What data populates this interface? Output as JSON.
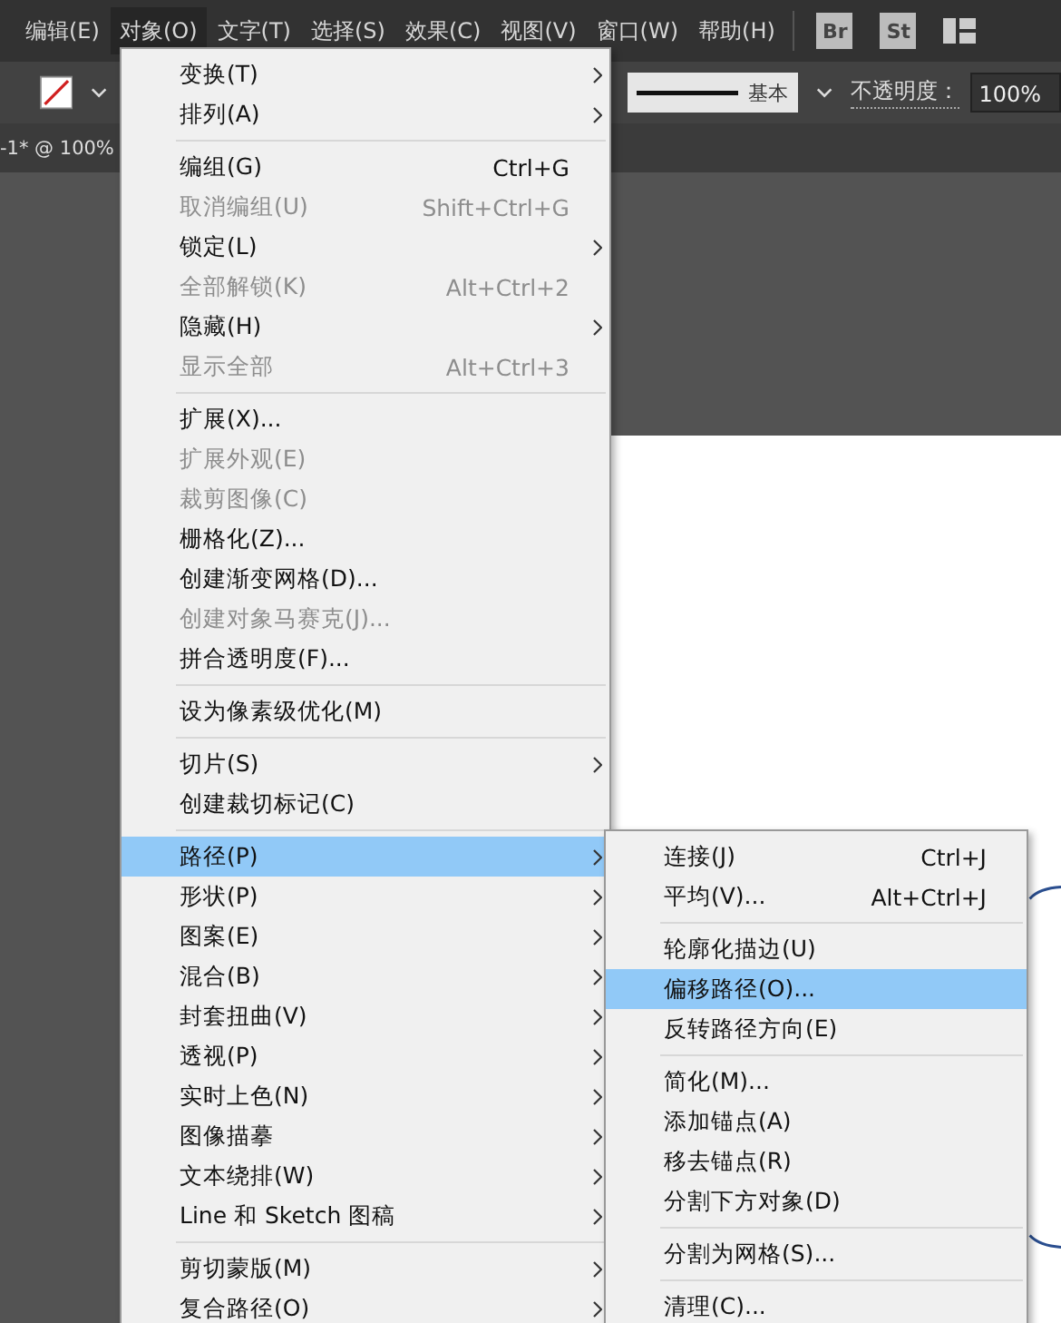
{
  "menubar": [
    {
      "label": "编辑(E)",
      "selected": false
    },
    {
      "label": "对象(O)",
      "selected": true
    },
    {
      "label": "文字(T)",
      "selected": false
    },
    {
      "label": "选择(S)",
      "selected": false
    },
    {
      "label": "效果(C)",
      "selected": false
    },
    {
      "label": "视图(V)",
      "selected": false
    },
    {
      "label": "窗口(W)",
      "selected": false
    },
    {
      "label": "帮助(H)",
      "selected": false
    }
  ],
  "app_buttons": [
    "Br",
    "St"
  ],
  "toolbar": {
    "stroke_style": "基本",
    "opacity_label": "不透明度：",
    "opacity_value": "100%"
  },
  "document_tab": {
    "title": "-1* @ 100%"
  },
  "menu": {
    "items": [
      {
        "kind": "item",
        "label": "变换(T)",
        "disabled": false,
        "submenu": true,
        "selected": false
      },
      {
        "kind": "item",
        "label": "排列(A)",
        "disabled": false,
        "submenu": true,
        "selected": false
      },
      {
        "kind": "separator"
      },
      {
        "kind": "item",
        "label": "编组(G)",
        "shortcut": "Ctrl+G",
        "disabled": false,
        "submenu": false,
        "selected": false
      },
      {
        "kind": "item",
        "label": "取消编组(U)",
        "shortcut": "Shift+Ctrl+G",
        "disabled": true,
        "submenu": false,
        "selected": false
      },
      {
        "kind": "item",
        "label": "锁定(L)",
        "disabled": false,
        "submenu": true,
        "selected": false
      },
      {
        "kind": "item",
        "label": "全部解锁(K)",
        "shortcut": "Alt+Ctrl+2",
        "disabled": true,
        "submenu": false,
        "selected": false
      },
      {
        "kind": "item",
        "label": "隐藏(H)",
        "disabled": false,
        "submenu": true,
        "selected": false
      },
      {
        "kind": "item",
        "label": "显示全部",
        "shortcut": "Alt+Ctrl+3",
        "disabled": true,
        "submenu": false,
        "selected": false
      },
      {
        "kind": "separator"
      },
      {
        "kind": "item",
        "label": "扩展(X)...",
        "disabled": false,
        "submenu": false,
        "selected": false
      },
      {
        "kind": "item",
        "label": "扩展外观(E)",
        "disabled": true,
        "submenu": false,
        "selected": false
      },
      {
        "kind": "item",
        "label": "裁剪图像(C)",
        "disabled": true,
        "submenu": false,
        "selected": false
      },
      {
        "kind": "item",
        "label": "栅格化(Z)...",
        "disabled": false,
        "submenu": false,
        "selected": false
      },
      {
        "kind": "item",
        "label": "创建渐变网格(D)...",
        "disabled": false,
        "submenu": false,
        "selected": false
      },
      {
        "kind": "item",
        "label": "创建对象马赛克(J)...",
        "disabled": true,
        "submenu": false,
        "selected": false
      },
      {
        "kind": "item",
        "label": "拼合透明度(F)...",
        "disabled": false,
        "submenu": false,
        "selected": false
      },
      {
        "kind": "separator"
      },
      {
        "kind": "item",
        "label": "设为像素级优化(M)",
        "disabled": false,
        "submenu": false,
        "selected": false
      },
      {
        "kind": "separator"
      },
      {
        "kind": "item",
        "label": "切片(S)",
        "disabled": false,
        "submenu": true,
        "selected": false
      },
      {
        "kind": "item",
        "label": "创建裁切标记(C)",
        "disabled": false,
        "submenu": false,
        "selected": false
      },
      {
        "kind": "separator"
      },
      {
        "kind": "item",
        "label": "路径(P)",
        "disabled": false,
        "submenu": true,
        "selected": true
      },
      {
        "kind": "item",
        "label": "形状(P)",
        "disabled": false,
        "submenu": true,
        "selected": false
      },
      {
        "kind": "item",
        "label": "图案(E)",
        "disabled": false,
        "submenu": true,
        "selected": false
      },
      {
        "kind": "item",
        "label": "混合(B)",
        "disabled": false,
        "submenu": true,
        "selected": false
      },
      {
        "kind": "item",
        "label": "封套扭曲(V)",
        "disabled": false,
        "submenu": true,
        "selected": false
      },
      {
        "kind": "item",
        "label": "透视(P)",
        "disabled": false,
        "submenu": true,
        "selected": false
      },
      {
        "kind": "item",
        "label": "实时上色(N)",
        "disabled": false,
        "submenu": true,
        "selected": false
      },
      {
        "kind": "item",
        "label": "图像描摹",
        "disabled": false,
        "submenu": true,
        "selected": false
      },
      {
        "kind": "item",
        "label": "文本绕排(W)",
        "disabled": false,
        "submenu": true,
        "selected": false
      },
      {
        "kind": "item",
        "label": "Line 和 Sketch 图稿",
        "disabled": false,
        "submenu": true,
        "selected": false
      },
      {
        "kind": "separator"
      },
      {
        "kind": "item",
        "label": "剪切蒙版(M)",
        "disabled": false,
        "submenu": true,
        "selected": false
      },
      {
        "kind": "item",
        "label": "复合路径(O)",
        "disabled": false,
        "submenu": true,
        "selected": false
      }
    ]
  },
  "submenu": {
    "items": [
      {
        "kind": "item",
        "label": "连接(J)",
        "shortcut": "Ctrl+J",
        "disabled": false,
        "submenu": false,
        "selected": false
      },
      {
        "kind": "item",
        "label": "平均(V)...",
        "shortcut": "Alt+Ctrl+J",
        "disabled": false,
        "submenu": false,
        "selected": false
      },
      {
        "kind": "separator"
      },
      {
        "kind": "item",
        "label": "轮廓化描边(U)",
        "disabled": false,
        "submenu": false,
        "selected": false
      },
      {
        "kind": "item",
        "label": "偏移路径(O)...",
        "disabled": false,
        "submenu": false,
        "selected": true
      },
      {
        "kind": "item",
        "label": "反转路径方向(E)",
        "disabled": false,
        "submenu": false,
        "selected": false
      },
      {
        "kind": "separator"
      },
      {
        "kind": "item",
        "label": "简化(M)...",
        "disabled": false,
        "submenu": false,
        "selected": false
      },
      {
        "kind": "item",
        "label": "添加锚点(A)",
        "disabled": false,
        "submenu": false,
        "selected": false
      },
      {
        "kind": "item",
        "label": "移去锚点(R)",
        "disabled": false,
        "submenu": false,
        "selected": false
      },
      {
        "kind": "item",
        "label": "分割下方对象(D)",
        "disabled": false,
        "submenu": false,
        "selected": false
      },
      {
        "kind": "separator"
      },
      {
        "kind": "item",
        "label": "分割为网格(S)...",
        "disabled": false,
        "submenu": false,
        "selected": false
      },
      {
        "kind": "separator"
      },
      {
        "kind": "item",
        "label": "清理(C)...",
        "disabled": false,
        "submenu": false,
        "selected": false
      }
    ]
  }
}
